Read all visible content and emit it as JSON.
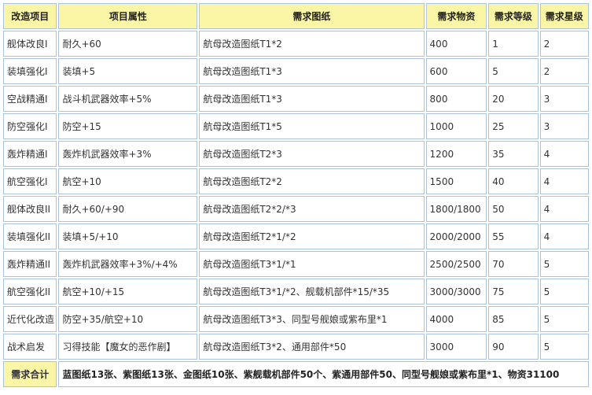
{
  "headers": [
    "改造项目",
    "项目属性",
    "需求图纸",
    "需求物资",
    "需求等级",
    "需求星级"
  ],
  "rows": [
    [
      "舰体改良I",
      "耐久+60",
      "航母改造图纸T1*2",
      "400",
      "1",
      "2"
    ],
    [
      "装填强化I",
      "装填+5",
      "航母改造图纸T1*3",
      "600",
      "5",
      "2"
    ],
    [
      "空战精通I",
      "战斗机武器效率+5%",
      "航母改造图纸T1*3",
      "800",
      "20",
      "3"
    ],
    [
      "防空强化I",
      "防空+15",
      "航母改造图纸T1*5",
      "1000",
      "25",
      "3"
    ],
    [
      "轰炸精通I",
      "轰炸机武器效率+3%",
      "航母改造图纸T2*3",
      "1200",
      "35",
      "4"
    ],
    [
      "航空强化I",
      "航空+10",
      "航母改造图纸T2*2",
      "1500",
      "40",
      "4"
    ],
    [
      "舰体改良II",
      "耐久+60/+90",
      "航母改造图纸T2*2/*3",
      "1800/1800",
      "50",
      "4"
    ],
    [
      "装填强化II",
      "装填+5/+10",
      "航母改造图纸T2*1/*2",
      "2000/2000",
      "55",
      "4"
    ],
    [
      "轰炸精通II",
      "轰炸机武器效率+3%/+4%",
      "航母改造图纸T3*1/*1",
      "2500/2500",
      "70",
      "5"
    ],
    [
      "航空强化II",
      "航空+10/+15",
      "航母改造图纸T3*1/*2、舰载机部件*15/*35",
      "3000/3000",
      "75",
      "5"
    ],
    [
      "近代化改造",
      "防空+35/航空+10",
      "航母改造图纸T3*3、同型号舰娘或紫布里*1",
      "4000",
      "85",
      "5"
    ],
    [
      "战术启发",
      "习得技能【魔女的恶作剧】",
      "航母改造图纸T3*2、通用部件*50",
      "3000",
      "90",
      "5"
    ]
  ],
  "summary": {
    "label": "需求合计",
    "text": "蓝图纸13张、紫图纸13张、金图纸10张、紫舰载机部件50个、紫通用部件50、同型号舰娘或紫布里*1、物资31100"
  }
}
